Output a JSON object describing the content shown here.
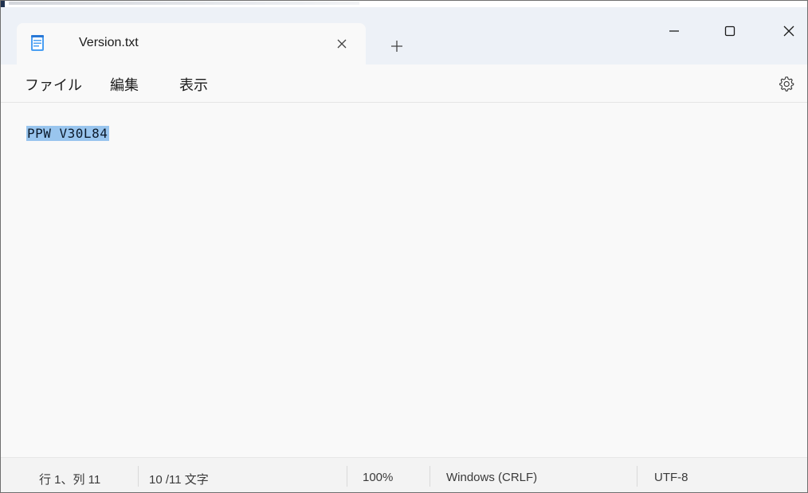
{
  "window": {
    "tab_title": "Version.txt",
    "tab_close_icon": "close-icon",
    "new_tab_icon": "plus-icon",
    "minimize_icon": "minimize-icon",
    "maximize_icon": "maximize-icon",
    "close_icon": "close-icon",
    "accent_color": "#edf1f7"
  },
  "menu": {
    "items": [
      "ファイル",
      "編集",
      "表示"
    ],
    "settings_icon": "gear-icon"
  },
  "editor": {
    "content": "PPW V30L84",
    "selection_color": "#99c5ee"
  },
  "status": {
    "position": "行 1、列 11",
    "char_count": "10 /11 文字",
    "zoom": "100%",
    "line_ending": "Windows (CRLF)",
    "encoding": "UTF-8"
  }
}
